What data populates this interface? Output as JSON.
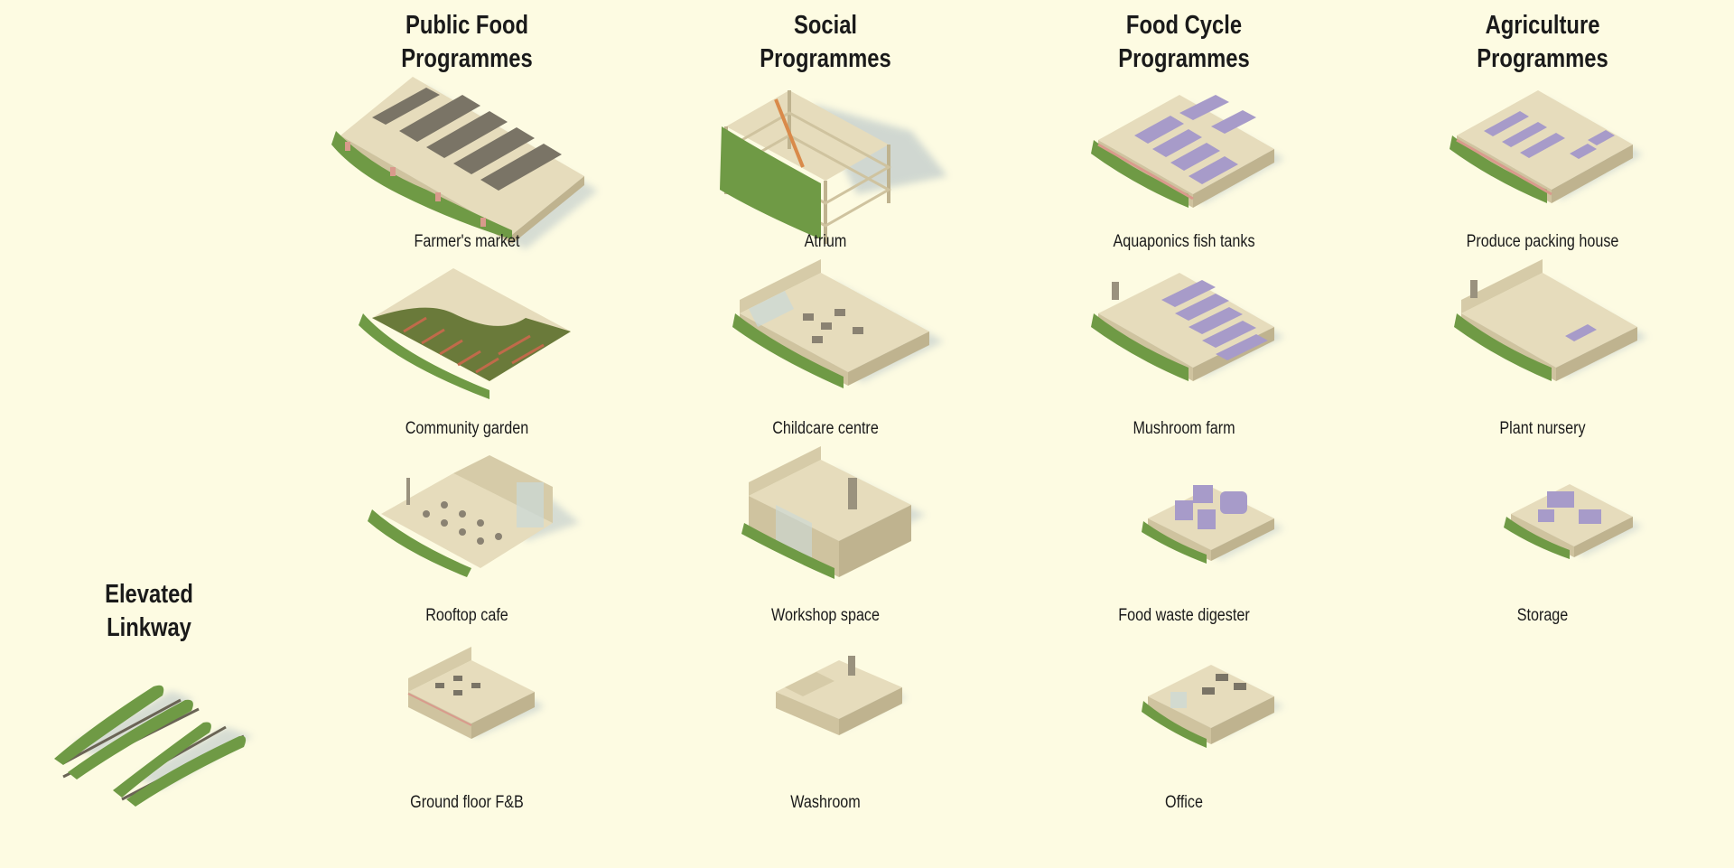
{
  "columns": [
    {
      "title_line1": "Public Food",
      "title_line2": "Programmes",
      "items": [
        "Farmer's market",
        "Community garden",
        "Rooftop cafe",
        "Ground floor F&B"
      ]
    },
    {
      "title_line1": "Social",
      "title_line2": "Programmes",
      "items": [
        "Atrium",
        "Childcare centre",
        "Workshop space",
        "Washroom"
      ]
    },
    {
      "title_line1": "Food Cycle",
      "title_line2": "Programmes",
      "items": [
        "Aquaponics fish tanks",
        "Mushroom farm",
        "Food waste digester",
        "Office"
      ]
    },
    {
      "title_line1": "Agriculture",
      "title_line2": "Programmes",
      "items": [
        "Produce packing house",
        "Plant nursery",
        "Storage"
      ]
    }
  ],
  "linkway": {
    "title_line1": "Elevated",
    "title_line2": "Linkway"
  },
  "colors": {
    "background": "#fdfbe2",
    "floor": "#e6dcbc",
    "wall": "#cfc39f",
    "greenery": "#6f9a45",
    "equipment_purple": "#a79bc9",
    "equipment_grey": "#7a7466",
    "accent_pink": "#d99a8c"
  }
}
